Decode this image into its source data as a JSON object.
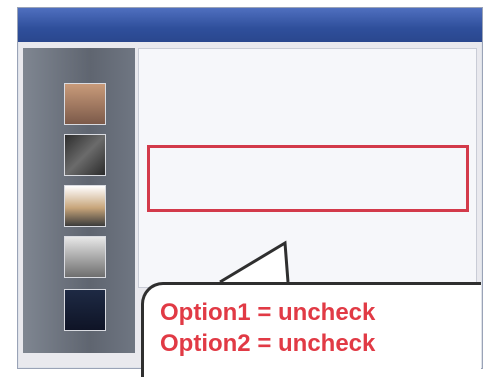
{
  "window": {
    "title": ""
  },
  "content": {
    "heading": "",
    "description": "",
    "option1": "",
    "option2": ""
  },
  "callout": {
    "line1": "Option1 = uncheck",
    "line2": "Option2 = uncheck"
  },
  "colors": {
    "titlebar": "#2f4f9b",
    "highlight": "#d33a4a",
    "callout_text": "#e13a45"
  }
}
